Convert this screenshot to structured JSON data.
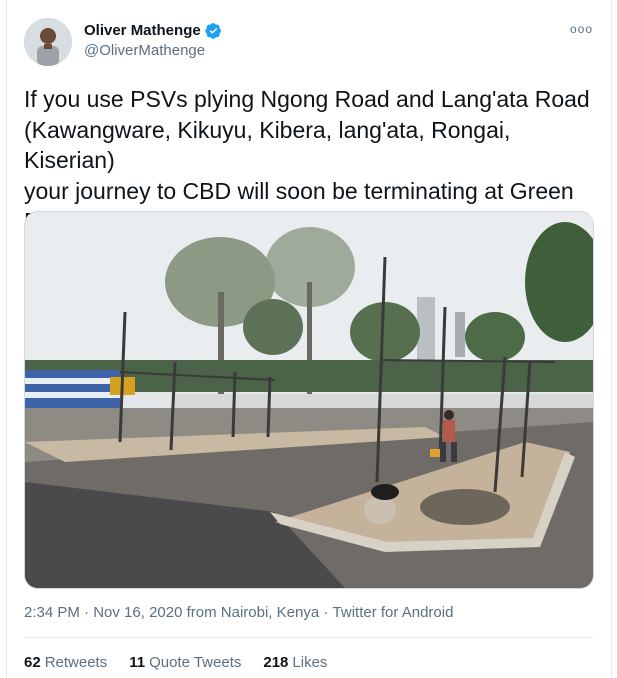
{
  "author": {
    "name": "Oliver Mathenge",
    "handle": "@OliverMathenge",
    "verified": true
  },
  "more_icon": "ooo",
  "tweet": {
    "line1": "If you use PSVs plying Ngong Road and Lang'ata Road",
    "line2": "(Kawangware, Kikuyu, Kibera, lang'ata, Rongai, Kiserian)",
    "line3": "your journey to CBD will soon be terminating at Green",
    "line4": "Park (formerly Railways club)."
  },
  "meta": {
    "time": "2:34 PM",
    "sep1": " · ",
    "date": "Nov 16, 2020",
    "location": " from Nairobi, Kenya",
    "sep2": " · ",
    "source": "Twitter for Android"
  },
  "stats": {
    "retweets_count": "62",
    "retweets_label": "Retweets",
    "quotes_count": "11",
    "quotes_label": "Quote Tweets",
    "likes_count": "218",
    "likes_label": "Likes"
  },
  "colors": {
    "text": "#0f1419",
    "secondary": "#5b7083",
    "verified": "#1da1f2",
    "border": "#e6ecf0"
  }
}
